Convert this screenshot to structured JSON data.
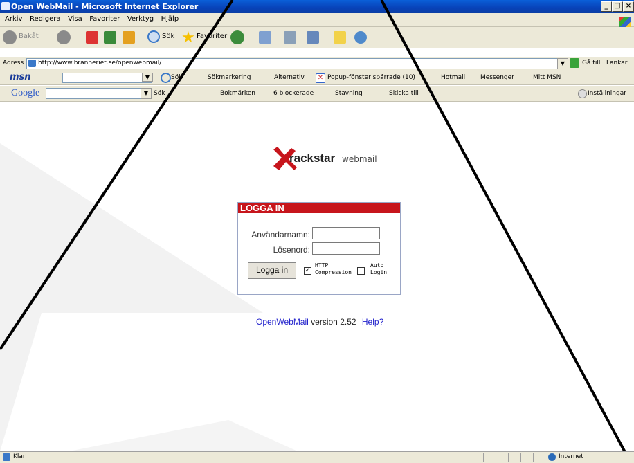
{
  "window": {
    "title": "Open WebMail - Microsoft Internet Explorer",
    "min": "_",
    "max": "□",
    "close": "×"
  },
  "menu": [
    "Arkiv",
    "Redigera",
    "Visa",
    "Favoriter",
    "Verktyg",
    "Hjälp"
  ],
  "toolbar": {
    "back": "Bakåt",
    "search": "Sök",
    "favorites": "Favoriter"
  },
  "address": {
    "label": "Adress",
    "url": "http://www.branneriet.se/openwebmail/",
    "go": "Gå till",
    "links": "Länkar"
  },
  "msn": {
    "logo": "msn",
    "search": "Sök",
    "highlight": "Sökmarkering",
    "options": "Alternativ",
    "popup": "Popup-fönster spärrade (10)",
    "hotmail": "Hotmail",
    "messenger": "Messenger",
    "mymsn": "Mitt MSN"
  },
  "google": {
    "logo": "Google",
    "search": "Sök",
    "bookmarks": "Bokmärken",
    "blocked": "6 blockerade",
    "spell": "Stavning",
    "send": "Skicka till",
    "settings": "Inställningar"
  },
  "logo": {
    "brand_mark": "X",
    "brand": "rackstar",
    "product": "webmail"
  },
  "login": {
    "header": "LOGGA IN",
    "username_label": "Användarnamn:",
    "password_label": "Lösenord:",
    "button": "Logga in",
    "http_compression": "HTTP Compression",
    "auto_login": "Auto Login",
    "http_compression_checked": true,
    "auto_login_checked": false
  },
  "footer": {
    "link": "OpenWebMail",
    "version_text": "version 2.52",
    "help": "Help?"
  },
  "status": {
    "text": "Klar",
    "zone": "Internet"
  }
}
